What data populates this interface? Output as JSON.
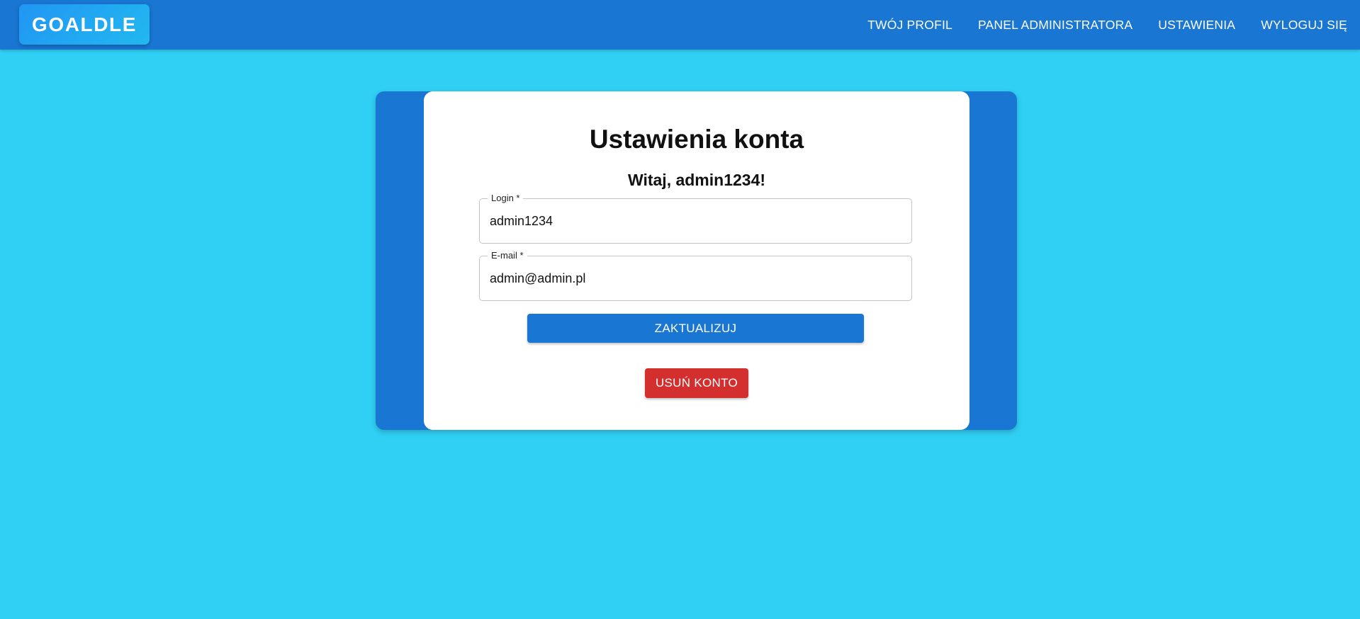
{
  "header": {
    "logo": "GOALDLE",
    "nav": [
      {
        "label": "TWÓJ PROFIL"
      },
      {
        "label": "PANEL ADMINISTRATORA"
      },
      {
        "label": "USTAWIENIA"
      },
      {
        "label": "WYLOGUJ SIĘ"
      }
    ]
  },
  "settings": {
    "title": "Ustawienia konta",
    "greeting": "Witaj, admin1234!",
    "login_label": "Login *",
    "login_value": "admin1234",
    "email_label": "E-mail *",
    "email_value": "admin@admin.pl",
    "update_label": "ZAKTUALIZUJ",
    "delete_label": "USUŃ KONTO"
  },
  "colors": {
    "background": "#30d0f5",
    "appbar": "#1976d2",
    "primary_button": "#1976d2",
    "danger_button": "#d32f2f",
    "card": "#ffffff"
  }
}
